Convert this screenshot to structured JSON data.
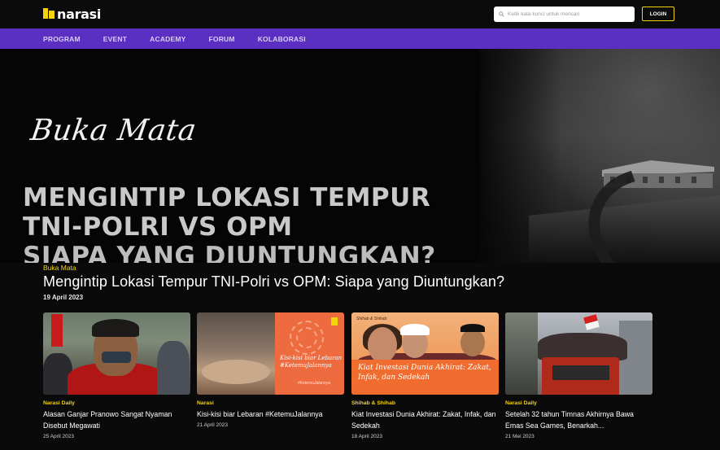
{
  "header": {
    "logo_text": "narasi",
    "search_placeholder": "Ketik kata kunci untuk mencari",
    "login_label": "LOGIN"
  },
  "nav": {
    "items": [
      "PROGRAM",
      "EVENT",
      "ACADEMY",
      "FORUM",
      "KOLABORASI"
    ]
  },
  "hero": {
    "script_title": "Buka Mata",
    "headline_lines": [
      "MENGINTIP LOKASI TEMPUR",
      "TNI-POLRI VS OPM",
      "SIAPA YANG DIUNTUNGKAN?"
    ]
  },
  "featured": {
    "category": "Buka Mata",
    "title": "Mengintip Lokasi Tempur TNI-Polri vs OPM: Siapa yang Diuntungkan?",
    "date": "19 April 2023"
  },
  "cards": [
    {
      "category": "Narasi Daily",
      "title": "Alasan Ganjar Pranowo Sangat Nyaman Disebut Megawati",
      "date": "25 April 2023"
    },
    {
      "category": "Narasi",
      "title": "Kisi-kisi biar Lebaran #KetemuJalannya",
      "date": "21 April 2023",
      "thumb_text": "Kisi-kisi biar Lebaran #KetemuJalannya",
      "thumb_small": "#KetemuJalannya"
    },
    {
      "category": "Shihab & Shihab",
      "title": "Kiat Investasi Dunia Akhirat: Zakat, Infak, dan Sedekah",
      "date": "18 April 2023",
      "thumb_header": "Shihab & Shihab",
      "thumb_text": "Kiat Investasi Dunia Akhirat: Zakat, Infak, dan Sedekah"
    },
    {
      "category": "Narasi Daily",
      "title": "Setelah 32 tahun Timnas Akhirnya Bawa Emas Sea Games, Benarkah...",
      "date": "21 Mei 2023"
    }
  ],
  "colors": {
    "nav_bg": "#5a2fc2",
    "accent_yellow": "#f5d50a",
    "page_bg": "#0a0a0a"
  },
  "icons": [
    "narasi-logo-icon",
    "search-icon"
  ]
}
